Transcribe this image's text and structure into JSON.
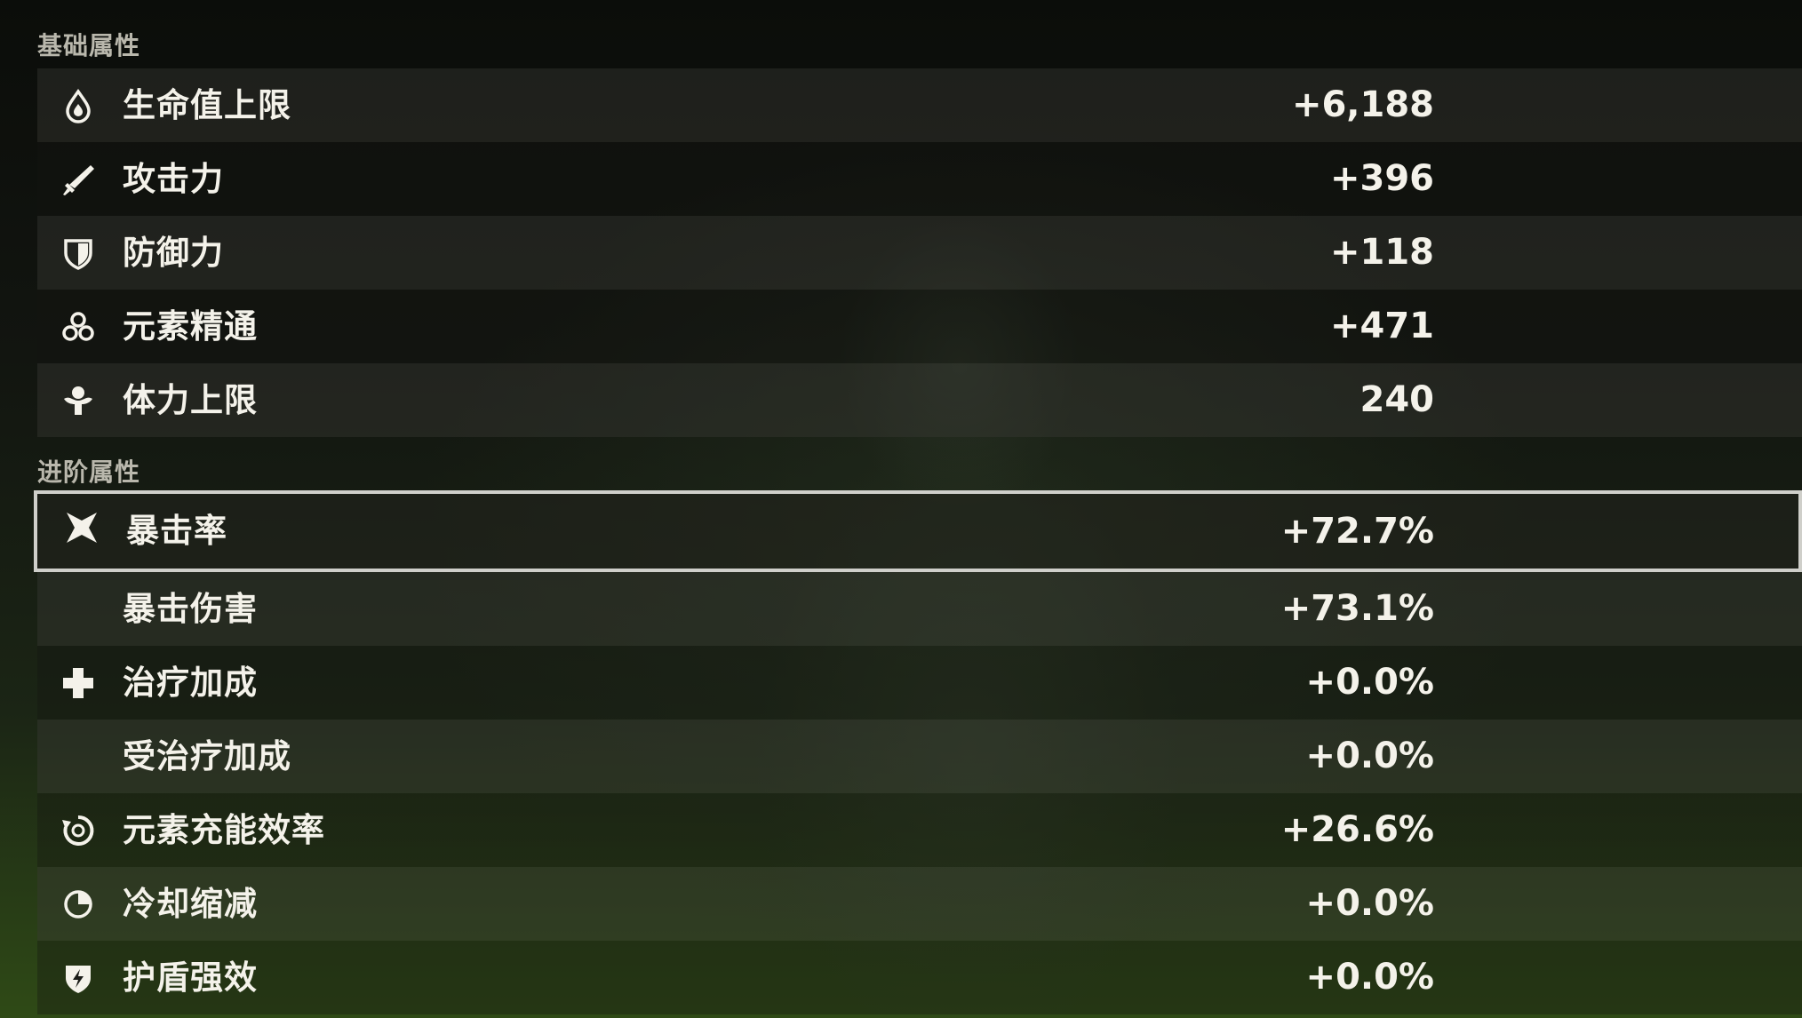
{
  "sections": {
    "basic": {
      "title": "基础属性",
      "stats": [
        {
          "icon": "hp-droplet-icon",
          "label": "生命值上限",
          "value": "+6,188"
        },
        {
          "icon": "atk-sword-icon",
          "label": "攻击力",
          "value": "+396"
        },
        {
          "icon": "def-shield-icon",
          "label": "防御力",
          "value": "+118"
        },
        {
          "icon": "elemental-mastery-icon",
          "label": "元素精通",
          "value": "+471"
        },
        {
          "icon": "stamina-icon",
          "label": "体力上限",
          "value": "240"
        }
      ]
    },
    "advanced": {
      "title": "进阶属性",
      "stats": [
        {
          "icon": "crit-rate-icon",
          "label": "暴击率",
          "value": "+72.7%",
          "selected": true
        },
        {
          "icon": "",
          "label": "暴击伤害",
          "value": "+73.1%"
        },
        {
          "icon": "healing-cross-icon",
          "label": "治疗加成",
          "value": "+0.0%"
        },
        {
          "icon": "",
          "label": "受治疗加成",
          "value": "+0.0%"
        },
        {
          "icon": "energy-recharge-icon",
          "label": "元素充能效率",
          "value": "+26.6%"
        },
        {
          "icon": "cooldown-icon",
          "label": "冷却缩减",
          "value": "+0.0%"
        },
        {
          "icon": "shield-strength-icon",
          "label": "护盾强效",
          "value": "+0.0%"
        }
      ]
    }
  },
  "colors": {
    "text": "#f4f2ea",
    "section_title": "#b9b7ac",
    "selected_border": "#cfcfca",
    "background_bottom": "#2f4a16"
  }
}
